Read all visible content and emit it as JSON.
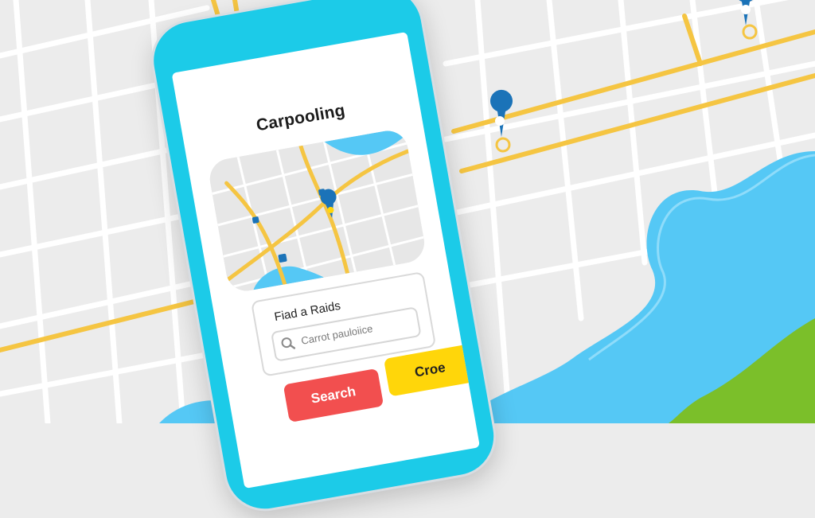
{
  "app": {
    "title": "Carpooling"
  },
  "find": {
    "label": "Fiad a Raids",
    "placeholder": "Carrot pauloiice"
  },
  "buttons": {
    "search": "Search",
    "close": "Croe"
  },
  "colors": {
    "phone": "#1ccbe8",
    "road": "#f5c542",
    "water": "#55c8f5",
    "pin": "#1b73b8",
    "search_button": "#f24f4f",
    "close_button": "#ffd60a",
    "grass": "#7bbf2a"
  },
  "icons": {
    "search": "search-icon",
    "pin": "location-pin-icon"
  }
}
